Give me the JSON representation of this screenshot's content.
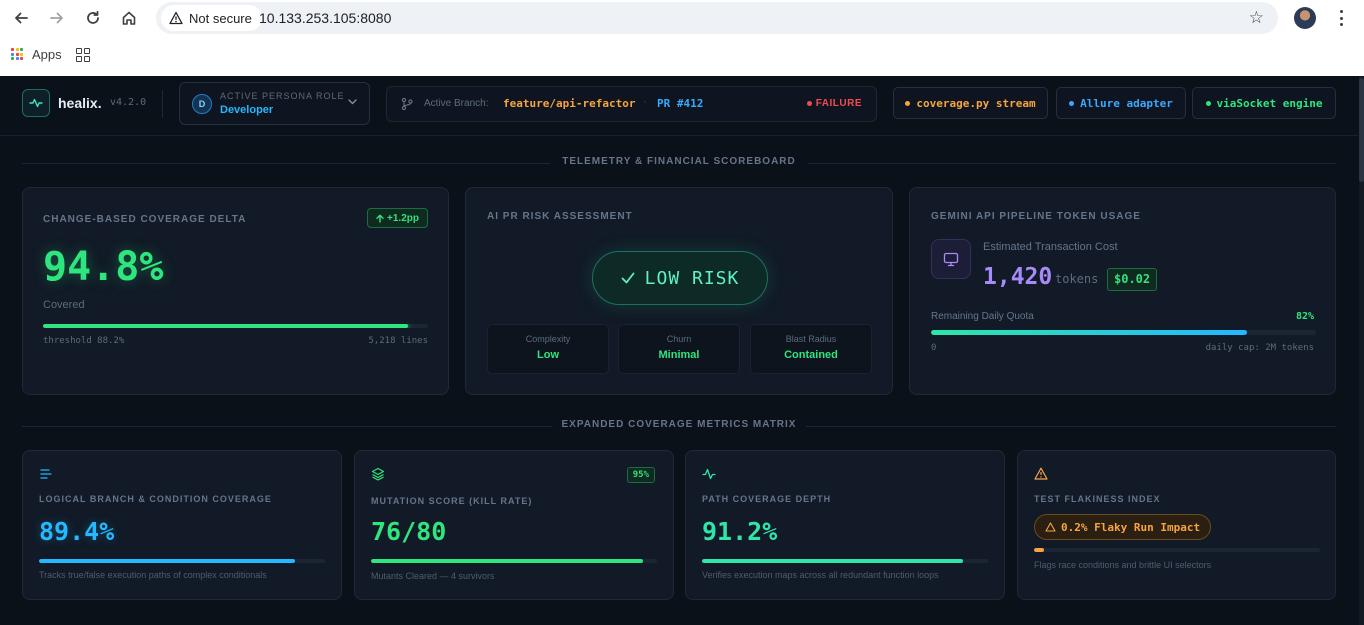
{
  "browser": {
    "security_label": "Not secure",
    "url": "10.133.253.105:8080",
    "bookmarks_apps_label": "Apps"
  },
  "header": {
    "logo_text": "healix.",
    "version": "v4.2.0",
    "persona": {
      "avatar_letter": "D",
      "caption": "ACTIVE PERSONA ROLE",
      "role": "Developer"
    },
    "branch": {
      "label": "Active Branch:",
      "name": "feature/api-refactor",
      "separator": "·",
      "pr": "PR #412",
      "status": "FAILURE"
    },
    "pills": [
      {
        "label": "coverage.py stream",
        "color": "#f7a440"
      },
      {
        "label": "Allure adapter",
        "color": "#39a9ff"
      },
      {
        "label": "viaSocket engine",
        "color": "#2ee67e"
      }
    ]
  },
  "sections": {
    "telemetry": "TELEMETRY & FINANCIAL SCOREBOARD",
    "matrix": "EXPANDED COVERAGE METRICS MATRIX"
  },
  "coverage_delta": {
    "caption": "CHANGE-BASED COVERAGE DELTA",
    "delta": "+1.2pp",
    "value": "94.8%",
    "sublabel": "Covered",
    "progress": 0.948,
    "threshold": "threshold 88.2%",
    "lines": "5,218 lines"
  },
  "risk": {
    "caption": "AI PR RISK ASSESSMENT",
    "level": "LOW RISK",
    "cells": [
      {
        "key": "Complexity",
        "value": "Low"
      },
      {
        "key": "Churn",
        "value": "Minimal"
      },
      {
        "key": "Blast Radius",
        "value": "Contained"
      }
    ]
  },
  "tokens": {
    "caption": "GEMINI API PIPELINE TOKEN USAGE",
    "cost_label": "Estimated Transaction Cost",
    "count": "1,420",
    "unit": "tokens",
    "cost": "$0.02",
    "quota_label": "Remaining Daily Quota",
    "quota_pct": "82%",
    "quota_progress": 0.82,
    "min_label": "0",
    "cap_label": "daily cap: 2M tokens"
  },
  "metrics": [
    {
      "icon": "align-left-icon",
      "caption": "LOGICAL BRANCH & CONDITION COVERAGE",
      "value": "89.4%",
      "progress": 0.894,
      "color": "#23b8ff",
      "desc": "Tracks true/false execution paths of complex conditionals",
      "badge": ""
    },
    {
      "icon": "layers-icon",
      "caption": "MUTATION SCORE (KILL RATE)",
      "value": "76/80",
      "progress": 0.95,
      "color": "#2ee67e",
      "desc": "Mutants Cleared — 4 survivors",
      "badge": "95%"
    },
    {
      "icon": "pulse-icon",
      "caption": "PATH COVERAGE DEPTH",
      "value": "91.2%",
      "progress": 0.912,
      "color": "#2ee6a8",
      "desc": "Verifies execution maps across all redundant function loops",
      "badge": ""
    },
    {
      "icon": "warning-icon",
      "caption": "TEST FLAKINESS INDEX",
      "value": "0.2% Flaky Run Impact",
      "progress": 0.035,
      "color": "#f7a440",
      "desc": "Flags race conditions and brittle UI selectors",
      "badge": ""
    }
  ]
}
